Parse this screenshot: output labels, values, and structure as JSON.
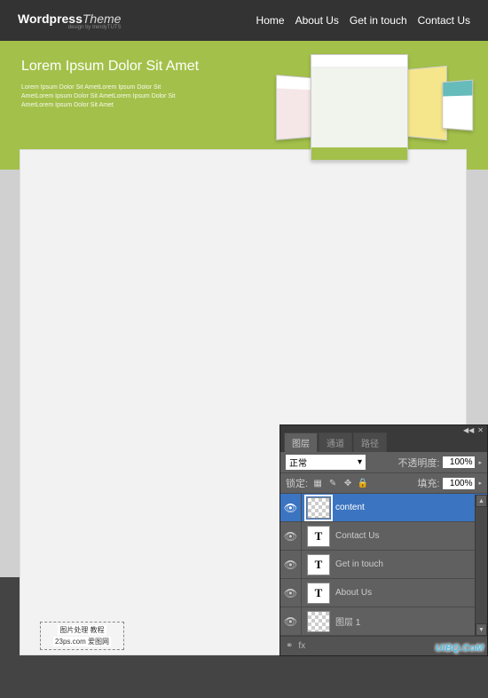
{
  "logo": {
    "bold": "Wordpress",
    "thin": "Theme",
    "sub": "design by trendyTUTS"
  },
  "nav": [
    "Home",
    "About Us",
    "Get in touch",
    "Contact Us"
  ],
  "hero": {
    "title": "Lorem Ipsum Dolor Sit Amet",
    "line1": "Lorem Ipsum Dolor Sit AmetLorem Ipsum Dolor Sit",
    "line2": "AmetLorem Ipsum Dolor Sit AmetLorem Ipsum Dolor Sit",
    "line3": "AmetLorem Ipsum Dolor Sit Amet"
  },
  "badge": {
    "l1": "图片处理 教程",
    "l2": "23ps.com 爱图网"
  },
  "panel": {
    "tabs": [
      "图层",
      "通道",
      "路径"
    ],
    "blend_label": "正常",
    "opacity_label": "不透明度:",
    "opacity_value": "100%",
    "lock_label": "锁定:",
    "fill_label": "填充:",
    "fill_value": "100%",
    "layers": [
      {
        "name": "content",
        "type": "trans",
        "selected": true
      },
      {
        "name": "Contact Us",
        "type": "T"
      },
      {
        "name": "Get in touch",
        "type": "T"
      },
      {
        "name": "About Us",
        "type": "T"
      },
      {
        "name": "图层 1",
        "type": "trans"
      }
    ]
  },
  "watermark": "UiBQ.CoM"
}
